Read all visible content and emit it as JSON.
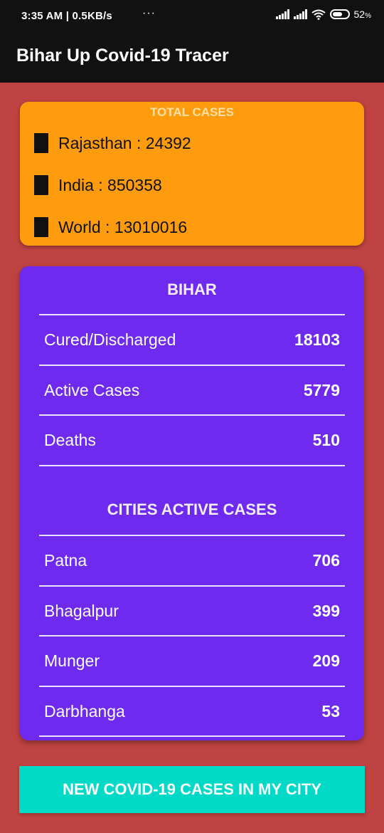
{
  "status_bar": {
    "time": "3:35 AM | 0.5KB/s",
    "more": "···",
    "battery_percent": "52",
    "battery_unit": "%"
  },
  "app": {
    "title": "Bihar Up Covid-19 Tracer"
  },
  "total_cases": {
    "heading": "TOTAL CASES",
    "rows": [
      {
        "label": "Rajasthan : 24392"
      },
      {
        "label": "India : 850358"
      },
      {
        "label": "World : 13010016"
      }
    ]
  },
  "bihar": {
    "heading": "BIHAR",
    "stats": [
      {
        "label": "Cured/Discharged",
        "value": "18103"
      },
      {
        "label": "Active Cases",
        "value": "5779"
      },
      {
        "label": "Deaths",
        "value": "510"
      }
    ]
  },
  "cities": {
    "heading": "CITIES ACTIVE CASES",
    "rows": [
      {
        "label": "Patna",
        "value": "706"
      },
      {
        "label": "Bhagalpur",
        "value": "399"
      },
      {
        "label": "Munger",
        "value": "209"
      },
      {
        "label": "Darbhanga",
        "value": "53"
      }
    ]
  },
  "actions": {
    "new_cases_button": "NEW COVID-19 CASES IN MY CITY"
  },
  "colors": {
    "background": "#BF4342",
    "app_bar": "#111111",
    "total_card": "#FF9C0E",
    "bihar_card": "#6F2AF0",
    "button": "#00D9C5"
  }
}
